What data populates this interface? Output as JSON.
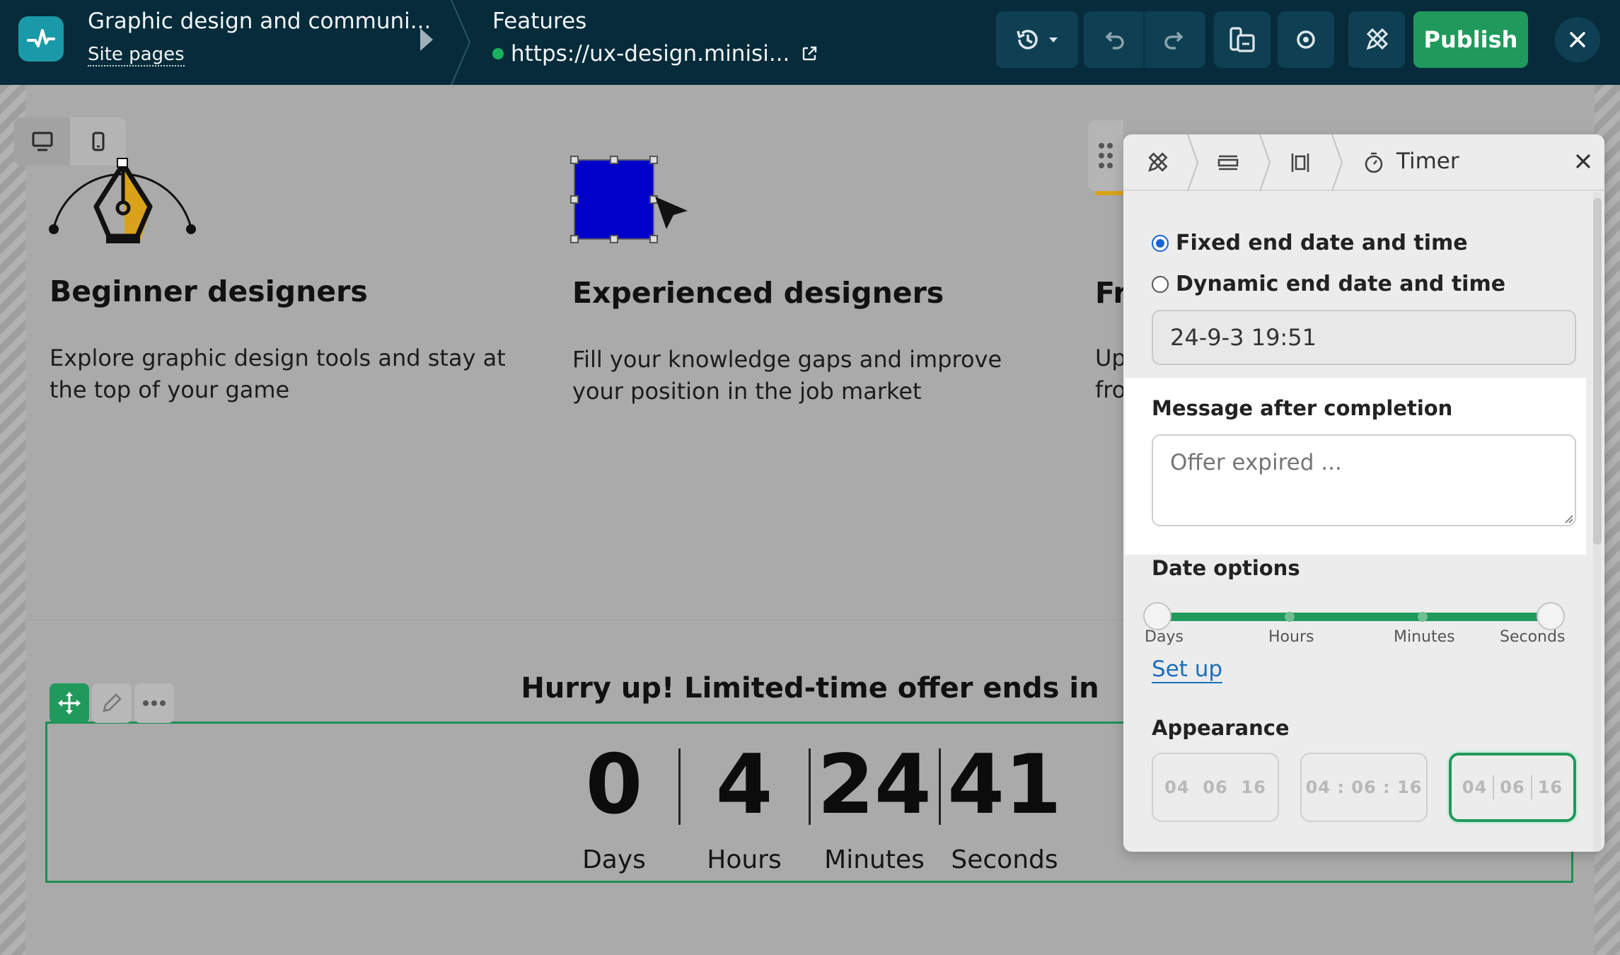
{
  "topbar": {
    "site_title": "Graphic design and communi...",
    "site_pages_label": "Site pages",
    "page_name": "Features",
    "page_url": "https://ux-design.minisi...",
    "publish_label": "Publish"
  },
  "features": [
    {
      "title": "Beginner designers",
      "description": "Explore graphic design tools and stay at the top of your game",
      "icon": "pen-tool-icon"
    },
    {
      "title": "Experienced designers",
      "description": "Fill your knowledge gaps and improve your position in the job market",
      "icon": "selected-square-cursor-icon"
    },
    {
      "title": "Fr",
      "description": "Up fro",
      "icon": "partial-icon"
    }
  ],
  "timer": {
    "headline": "Hurry up! Limited-time offer ends in",
    "units": [
      {
        "value": "0",
        "label": "Days"
      },
      {
        "value": "4",
        "label": "Hours"
      },
      {
        "value": "24",
        "label": "Minutes"
      },
      {
        "value": "41",
        "label": "Seconds"
      }
    ]
  },
  "panel": {
    "title": "Timer",
    "radio_fixed": "Fixed end date and time",
    "radio_dynamic": "Dynamic end date and time",
    "selected_mode": "fixed",
    "end_date_value": "24-9-3 19:51",
    "message_label": "Message after completion",
    "message_placeholder": "Offer expired ...",
    "date_options_label": "Date options",
    "date_options_ticks": [
      "Days",
      "Hours",
      "Minutes",
      "Seconds"
    ],
    "setup_link": "Set up",
    "appearance_label": "Appearance",
    "appearance_options": [
      {
        "h": "04",
        "m": "06",
        "s": "16",
        "style": "plain"
      },
      {
        "text": "04 : 06 : 16",
        "style": "colon"
      },
      {
        "h": "04",
        "m": "06",
        "s": "16",
        "style": "divider",
        "selected": true
      }
    ]
  },
  "colors": {
    "topbar_bg": "#062b3a",
    "publish_green": "#1f9a5c",
    "link_blue": "#1b6fb8",
    "radio_blue": "#1565d8"
  }
}
